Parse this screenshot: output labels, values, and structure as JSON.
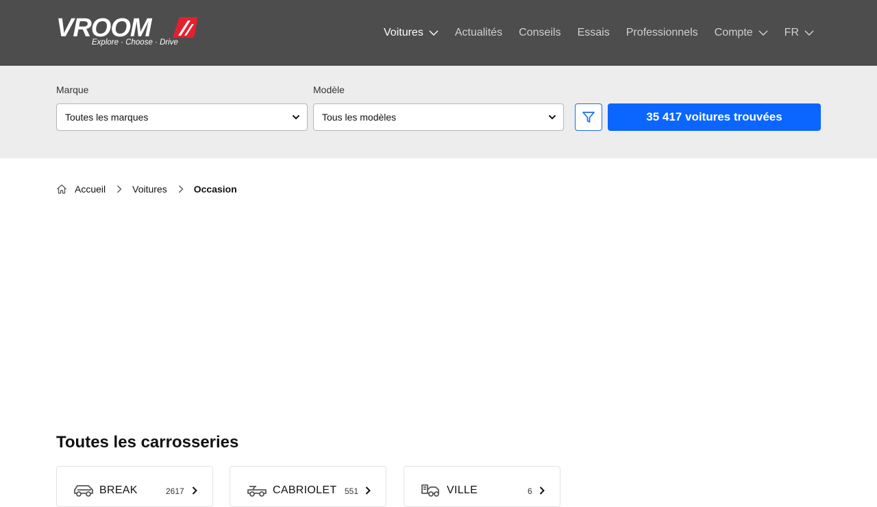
{
  "header": {
    "logo": {
      "wordmark": "VROOM",
      "tagline": "Explore · Choose · Drive"
    },
    "nav": [
      {
        "label": "Voitures",
        "dropdown": true,
        "active": true
      },
      {
        "label": "Actualités",
        "dropdown": false,
        "active": false
      },
      {
        "label": "Conseils",
        "dropdown": false,
        "active": false
      },
      {
        "label": "Essais",
        "dropdown": false,
        "active": false
      },
      {
        "label": "Professionnels",
        "dropdown": false,
        "active": false
      },
      {
        "label": "Compte",
        "dropdown": true,
        "active": false
      },
      {
        "label": "FR",
        "dropdown": true,
        "active": false
      }
    ]
  },
  "search": {
    "brand_label": "Marque",
    "brand_value": "Toutes les marques",
    "model_label": "Modèle",
    "model_value": "Tous les modèles",
    "filter_icon": "filter-icon",
    "results_label": "35 417 voitures trouvées"
  },
  "breadcrumb": {
    "items": [
      "Accueil",
      "Voitures"
    ],
    "current": "Occasion"
  },
  "bodies": {
    "title": "Toutes les carrosseries",
    "cards": [
      {
        "label": "BREAK",
        "count": "2617",
        "icon": "station-wagon-icon"
      },
      {
        "label": "CABRIOLET",
        "count": "551",
        "icon": "convertible-icon"
      },
      {
        "label": "VILLE",
        "count": "6",
        "icon": "city-car-icon"
      }
    ]
  },
  "colors": {
    "header_bg": "#4d4d4d",
    "search_bg": "#ededed",
    "primary": "#0a66ff",
    "logo_accent": "#e4202f"
  }
}
